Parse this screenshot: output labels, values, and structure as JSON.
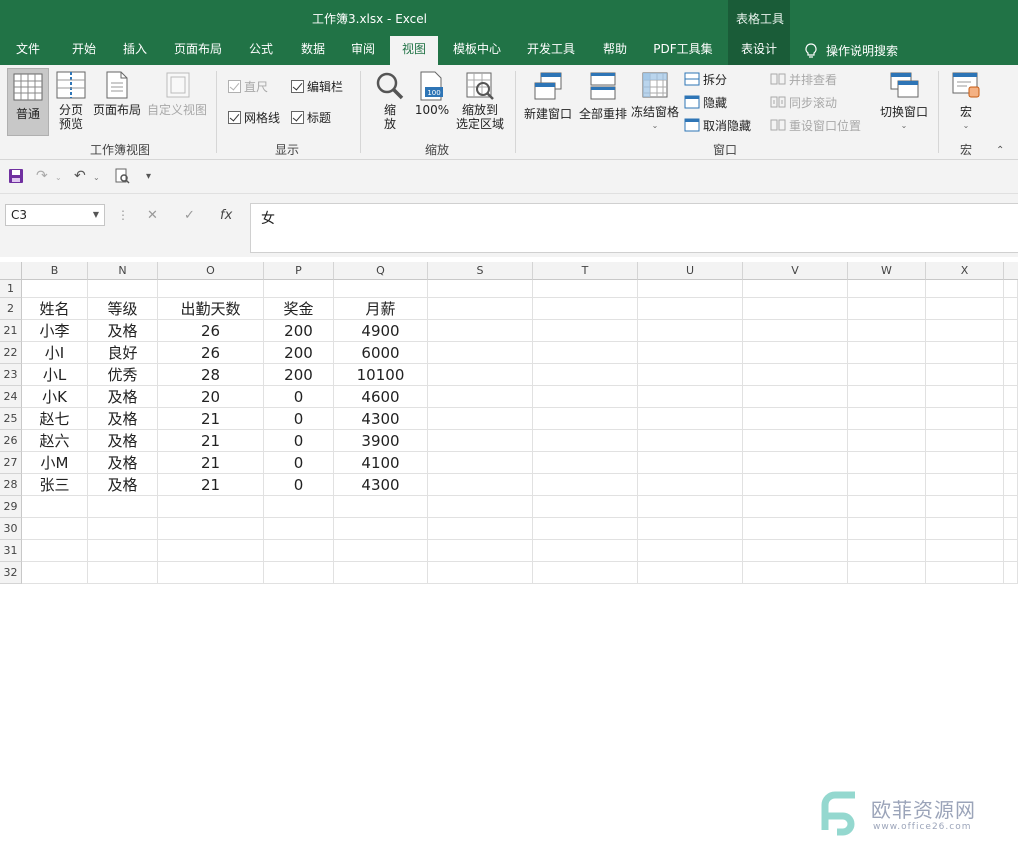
{
  "window": {
    "title": "工作簿3.xlsx  -  Excel",
    "context_tools": "表格工具"
  },
  "tabs": [
    {
      "label": "文件"
    },
    {
      "label": "开始"
    },
    {
      "label": "插入"
    },
    {
      "label": "页面布局"
    },
    {
      "label": "公式"
    },
    {
      "label": "数据"
    },
    {
      "label": "审阅"
    },
    {
      "label": "视图",
      "active": true
    },
    {
      "label": "模板中心"
    },
    {
      "label": "开发工具"
    },
    {
      "label": "帮助"
    },
    {
      "label": "PDF工具集"
    },
    {
      "label": "表设计"
    },
    {
      "label": "操作说明搜索"
    }
  ],
  "ribbon": {
    "workbook_views": {
      "label": "工作簿视图",
      "normal": "普通",
      "page_break_1": "分页",
      "page_break_2": "预览",
      "page_layout": "页面布局",
      "custom_view": "自定义视图"
    },
    "show": {
      "label": "显示",
      "ruler": "直尺",
      "formula_bar": "编辑栏",
      "gridlines": "网格线",
      "headings": "标题"
    },
    "zoom": {
      "label": "缩放",
      "zoom_1": "缩",
      "zoom_2": "放",
      "hundred": "100%",
      "to_selection_1": "缩放到",
      "to_selection_2": "选定区域"
    },
    "window": {
      "label": "窗口",
      "new_window": "新建窗口",
      "arrange_all": "全部重排",
      "freeze_panes": "冻结窗格",
      "split": "拆分",
      "hide": "隐藏",
      "unhide": "取消隐藏",
      "side_by_side": "并排查看",
      "sync_scroll": "同步滚动",
      "reset_position": "重设窗口位置",
      "switch_windows": "切换窗口"
    },
    "macros": {
      "label": "宏",
      "macros": "宏"
    }
  },
  "formula_bar": {
    "name_box": "C3",
    "content": "女",
    "fx": "fx"
  },
  "sheet": {
    "columns": [
      "B",
      "N",
      "O",
      "P",
      "Q",
      "S",
      "T",
      "U",
      "V",
      "W",
      "X"
    ],
    "rows": [
      {
        "num": "1",
        "cells": [
          "",
          "",
          "",
          "",
          ""
        ]
      },
      {
        "num": "2",
        "cells": [
          "姓名",
          "等级",
          "出勤天数",
          "奖金",
          "月薪"
        ]
      },
      {
        "num": "21",
        "cells": [
          "小李",
          "及格",
          "26",
          "200",
          "4900"
        ]
      },
      {
        "num": "22",
        "cells": [
          "小I",
          "良好",
          "26",
          "200",
          "6000"
        ]
      },
      {
        "num": "23",
        "cells": [
          "小L",
          "优秀",
          "28",
          "200",
          "10100"
        ]
      },
      {
        "num": "24",
        "cells": [
          "小K",
          "及格",
          "20",
          "0",
          "4600"
        ]
      },
      {
        "num": "25",
        "cells": [
          "赵七",
          "及格",
          "21",
          "0",
          "4300"
        ]
      },
      {
        "num": "26",
        "cells": [
          "赵六",
          "及格",
          "21",
          "0",
          "3900"
        ]
      },
      {
        "num": "27",
        "cells": [
          "小M",
          "及格",
          "21",
          "0",
          "4100"
        ]
      },
      {
        "num": "28",
        "cells": [
          "张三",
          "及格",
          "21",
          "0",
          "4300"
        ]
      },
      {
        "num": "29",
        "cells": [
          "",
          "",
          "",
          "",
          ""
        ]
      },
      {
        "num": "30",
        "cells": [
          "",
          "",
          "",
          "",
          ""
        ]
      },
      {
        "num": "31",
        "cells": [
          "",
          "",
          "",
          "",
          ""
        ]
      },
      {
        "num": "32",
        "cells": [
          "",
          "",
          "",
          "",
          ""
        ]
      }
    ]
  },
  "watermark": {
    "brand": "欧菲资源网",
    "url": "www.office26.com"
  },
  "colors": {
    "excel_green": "#217346",
    "ribbon_bg": "#f3f3f3"
  }
}
